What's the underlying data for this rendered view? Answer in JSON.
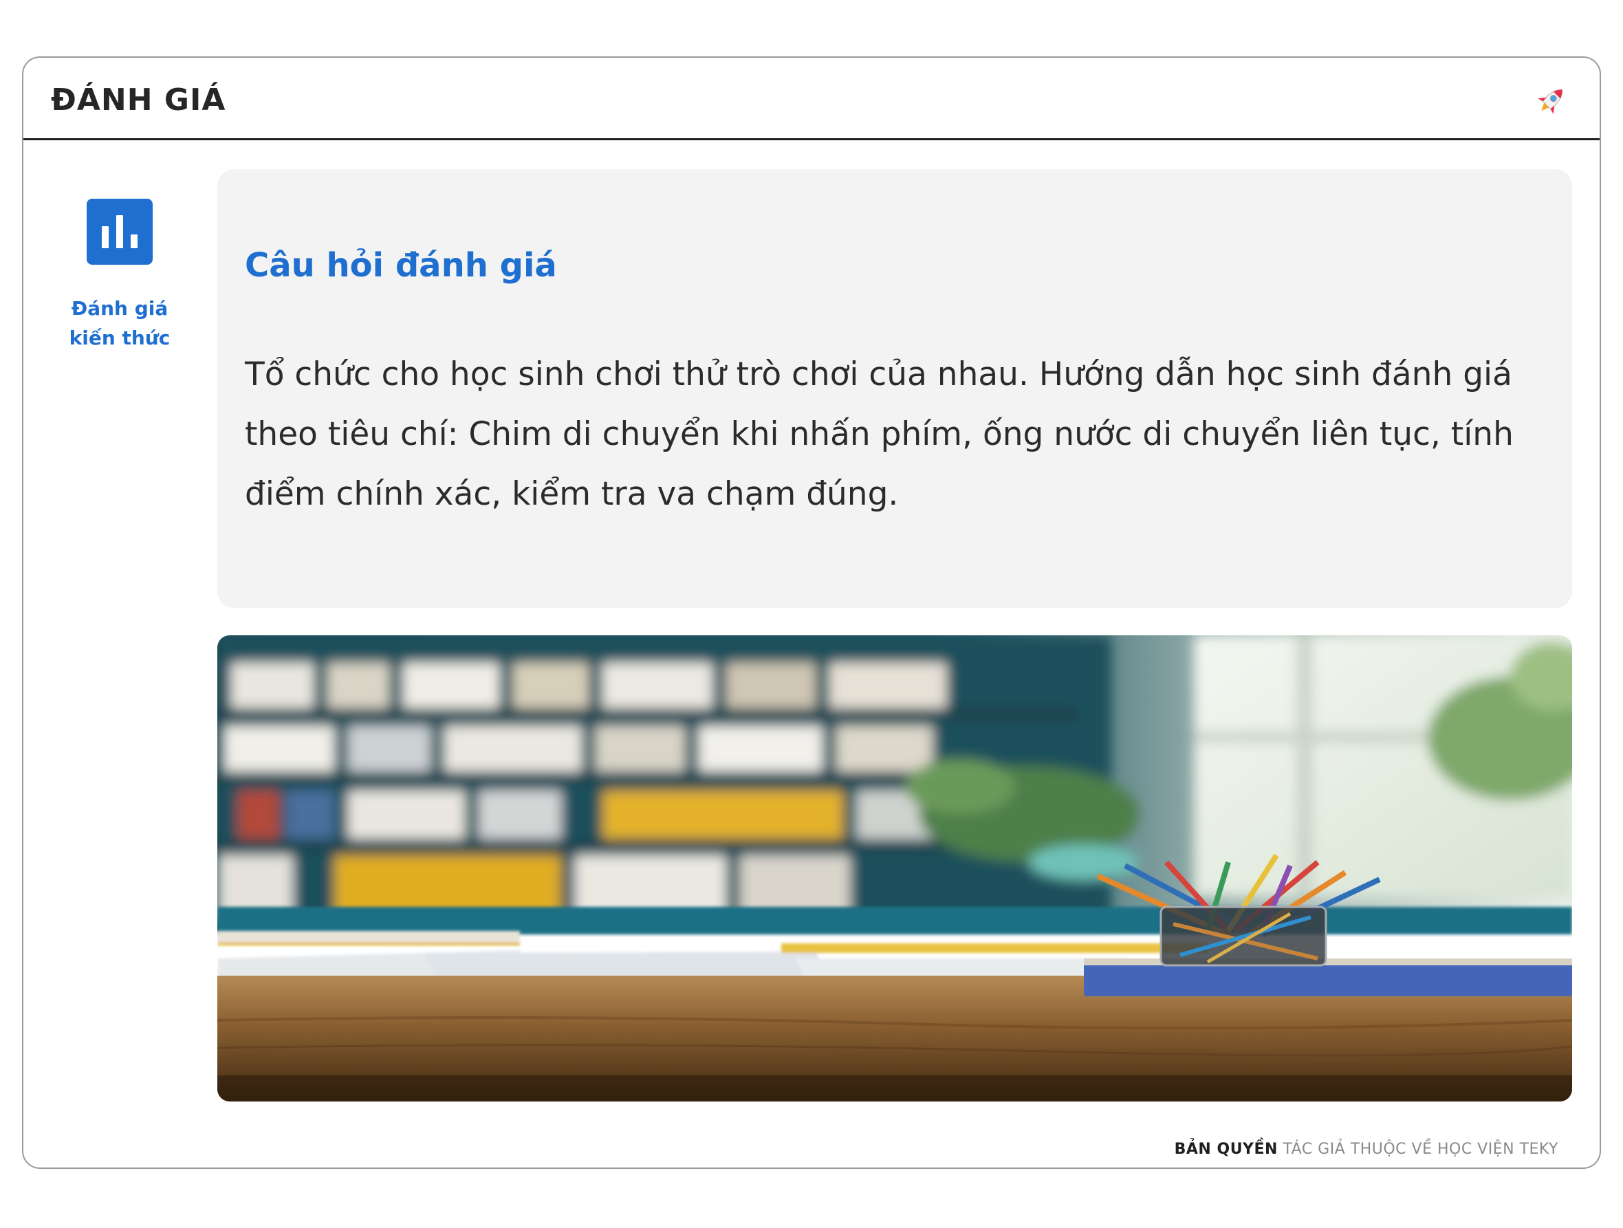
{
  "header": {
    "title": "ĐÁNH GIÁ",
    "icon": "rocket-icon"
  },
  "sidebar": {
    "icon": "bar-chart-icon",
    "label_line1": "Đánh giá",
    "label_line2": "kiến thức",
    "accent_color": "#1f6fd0"
  },
  "card": {
    "title": "Câu hỏi đánh giá",
    "text": "Tổ chức cho học sinh chơi thử trò chơi của nhau. Hướng dẫn học sinh đánh giá theo tiêu chí: Chim di chuyển khi nhấn phím, ống nước di chuyển liên tục, tính điểm chính xác, kiểm tra va chạm đúng."
  },
  "image": {
    "subject": "classroom-desk-with-pencils-photo"
  },
  "footer": {
    "copyright_strong": "BẢN QUYỀN",
    "copyright_rest": "TÁC GIẢ THUỘC VỀ HỌC VIỆN TEKY"
  }
}
